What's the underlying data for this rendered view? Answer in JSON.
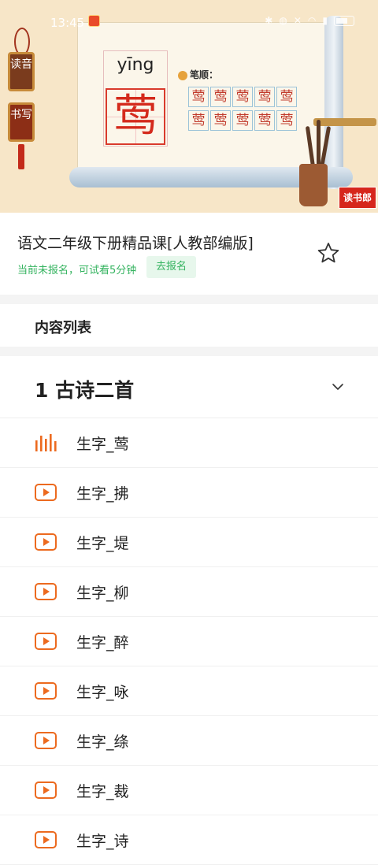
{
  "status_bar": {
    "time": "13:45",
    "icons": [
      "bluetooth-icon",
      "mute-icon",
      "dnd-icon",
      "wifi-icon",
      "signal-icon",
      "battery-icon"
    ]
  },
  "hero": {
    "pinyin": "yīng",
    "character": "莺",
    "stroke_label": "笔顺：",
    "stroke_chars": [
      "莺",
      "莺",
      "莺",
      "莺",
      "莺",
      "莺",
      "莺",
      "莺",
      "莺",
      "莺"
    ],
    "plaque_read": "读音",
    "plaque_write": "书写",
    "logo_text": "读书郎"
  },
  "course": {
    "title": "语文二年级下册精品课[人教部编版]",
    "trial_text": "当前未报名，可试看5分钟",
    "enroll_label": "去报名"
  },
  "content_list": {
    "header": "内容列表",
    "chapter_title": "1 古诗二首",
    "lessons": [
      {
        "label": "生字_莺",
        "playing": true
      },
      {
        "label": "生字_拂",
        "playing": false
      },
      {
        "label": "生字_堤",
        "playing": false
      },
      {
        "label": "生字_柳",
        "playing": false
      },
      {
        "label": "生字_醉",
        "playing": false
      },
      {
        "label": "生字_咏",
        "playing": false
      },
      {
        "label": "生字_绦",
        "playing": false
      },
      {
        "label": "生字_裁",
        "playing": false
      },
      {
        "label": "生字_诗",
        "playing": false
      }
    ]
  },
  "colors": {
    "accent_orange": "#ec6a1f",
    "green": "#34b35f",
    "red": "#d42a1c"
  }
}
